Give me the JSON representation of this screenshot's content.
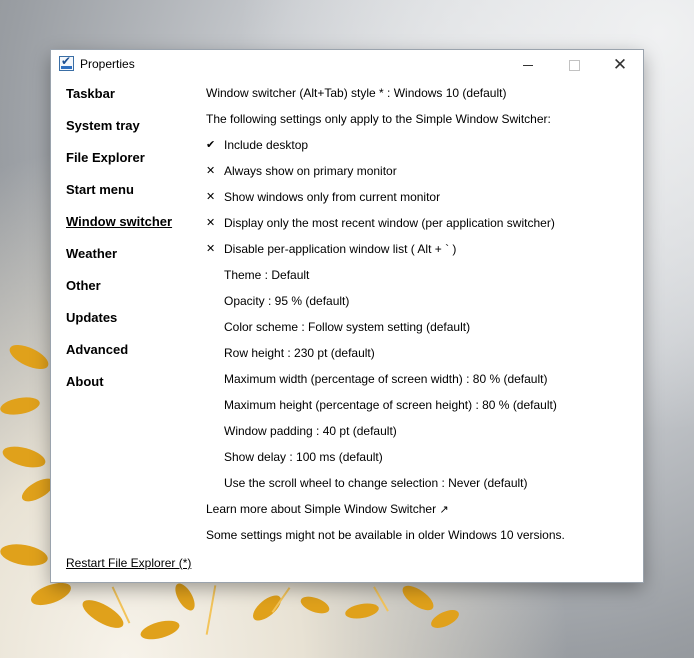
{
  "window": {
    "title": "Properties"
  },
  "controls": {
    "close_glyph": "✕"
  },
  "nav": {
    "items": [
      "Taskbar",
      "System tray",
      "File Explorer",
      "Start menu",
      "Window switcher",
      "Weather",
      "Other",
      "Updates",
      "Advanced",
      "About"
    ],
    "active_index": 4
  },
  "settings": {
    "style_line": "Window switcher (Alt+Tab) style * : Windows 10 (default)",
    "intro_line": "The following settings only apply to the Simple Window Switcher:",
    "toggles": [
      {
        "mark": "✔",
        "label": "Include desktop"
      },
      {
        "mark": "✕",
        "label": "Always show on primary monitor"
      },
      {
        "mark": "✕",
        "label": "Show windows only from current monitor"
      },
      {
        "mark": "✕",
        "label": "Display only the most recent window (per application switcher)"
      },
      {
        "mark": "✕",
        "label": "Disable per-application window list ( Alt + ` )"
      }
    ],
    "options": [
      "Theme : Default",
      "Opacity : 95 % (default)",
      "Color scheme : Follow system setting (default)",
      "Row height : 230 pt (default)",
      "Maximum width (percentage of screen width) : 80 % (default)",
      "Maximum height (percentage of screen height) : 80 % (default)",
      "Window padding : 40 pt (default)",
      "Show delay : 100 ms (default)",
      "Use the scroll wheel to change selection : Never (default)"
    ],
    "learn_more": "Learn more about Simple Window Switcher",
    "learn_more_glyph": "↗",
    "note": "Some settings might not be available in older Windows 10 versions."
  },
  "footer": {
    "restart": "Restart File Explorer (*)"
  }
}
